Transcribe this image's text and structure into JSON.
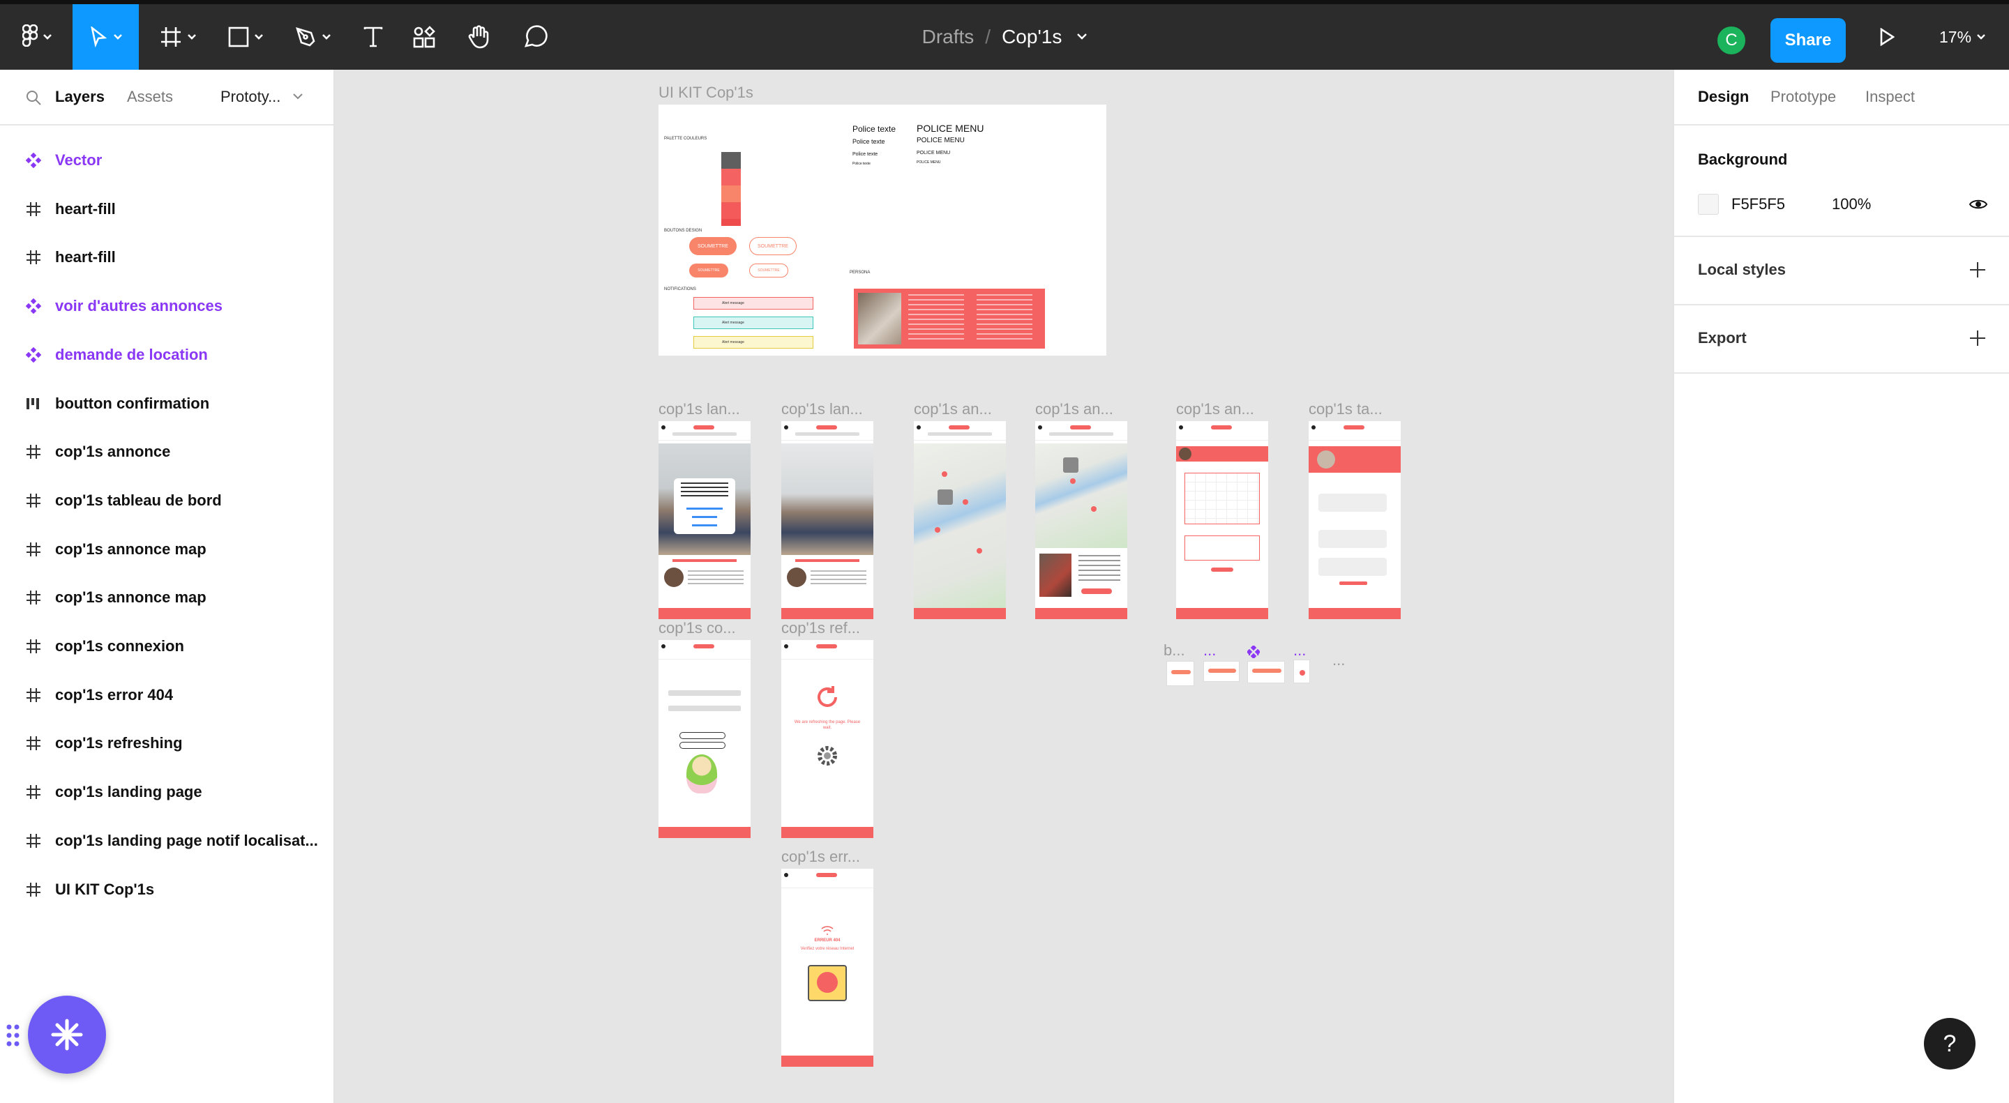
{
  "toolbar": {
    "breadcrumb_drafts": "Drafts",
    "breadcrumb_sep": "/",
    "file_name": "Cop'1s",
    "avatar_initial": "C",
    "share_label": "Share",
    "zoom_level": "17%",
    "icons": [
      "figma-menu-icon",
      "move-tool-icon",
      "frame-tool-icon",
      "shape-tool-icon",
      "pen-tool-icon",
      "text-tool-icon",
      "resources-icon",
      "hand-tool-icon",
      "comment-tool-icon",
      "present-icon"
    ]
  },
  "left_panel": {
    "tab_layers": "Layers",
    "tab_assets": "Assets",
    "tab_page": "Prototy...",
    "layers": [
      {
        "label": "Vector",
        "kind": "component"
      },
      {
        "label": "heart-fill",
        "kind": "frame"
      },
      {
        "label": "heart-fill",
        "kind": "frame"
      },
      {
        "label": "voir d'autres annonces",
        "kind": "component"
      },
      {
        "label": "demande de location",
        "kind": "component"
      },
      {
        "label": "boutton confirmation",
        "kind": "autolayout"
      },
      {
        "label": "cop'1s annonce",
        "kind": "frame"
      },
      {
        "label": "cop'1s tableau de bord",
        "kind": "frame"
      },
      {
        "label": "cop'1s annonce map",
        "kind": "frame"
      },
      {
        "label": "cop'1s annonce map",
        "kind": "frame"
      },
      {
        "label": "cop'1s connexion",
        "kind": "frame"
      },
      {
        "label": "cop'1s error 404",
        "kind": "frame"
      },
      {
        "label": "cop'1s refreshing",
        "kind": "frame"
      },
      {
        "label": "cop'1s landing page",
        "kind": "frame"
      },
      {
        "label": "cop'1s landing page notif localisat...",
        "kind": "frame"
      },
      {
        "label": "UI KIT Cop'1s",
        "kind": "frame"
      }
    ]
  },
  "canvas": {
    "frame_labels": {
      "ui_kit": "UI KIT Cop'1s",
      "landing1": "cop'1s lan...",
      "landing2": "cop'1s lan...",
      "map1": "cop'1s an...",
      "map2": "cop'1s an...",
      "annonce": "cop'1s an...",
      "tableau": "cop'1s ta...",
      "connexion": "cop'1s co...",
      "refresh": "cop'1s ref...",
      "error": "cop'1s err...",
      "b": "b...",
      "dots1": "...",
      "dots2": "...",
      "dots3": "...",
      "dots4": "..."
    },
    "ui_kit": {
      "palette_label": "PALETTE COULEURS",
      "buttons_label": "BOUTONS DESIGN",
      "notifications_label": "NOTIFICATIONS",
      "persona_label": "PERSONA",
      "police_texte_1": "Police texte",
      "police_texte_2": "Police texte",
      "police_texte_3": "Police texte",
      "police_texte_4": "Police texte",
      "police_menu_1": "POLICE MENU",
      "police_menu_2": "POLICE MENU",
      "police_menu_3": "POLICE MENU",
      "police_menu_4": "POLICE MENU",
      "btn_soumettre": "SOUMETTRE",
      "alert_message": "Alert message",
      "palette": [
        "#5f5f5f",
        "#f46262",
        "#f8846a",
        "#f46262",
        "#f46262"
      ]
    },
    "refresh_text": "We are refreshing the page. Please wait.",
    "error_code": "ERREUR 404",
    "error_text": "Verifiez votre réseau Internet"
  },
  "right_panel": {
    "tab_design": "Design",
    "tab_prototype": "Prototype",
    "tab_inspect": "Inspect",
    "background_title": "Background",
    "background_hex": "F5F5F5",
    "background_opacity": "100%",
    "local_styles": "Local styles",
    "export": "Export",
    "help": "?"
  },
  "colors": {
    "toolbar_bg": "#2c2c2c",
    "accent_blue": "#0d99ff",
    "brand_red": "#f46262",
    "component_purple": "#8a38f5",
    "canvas_bg": "#e5e5e5"
  }
}
